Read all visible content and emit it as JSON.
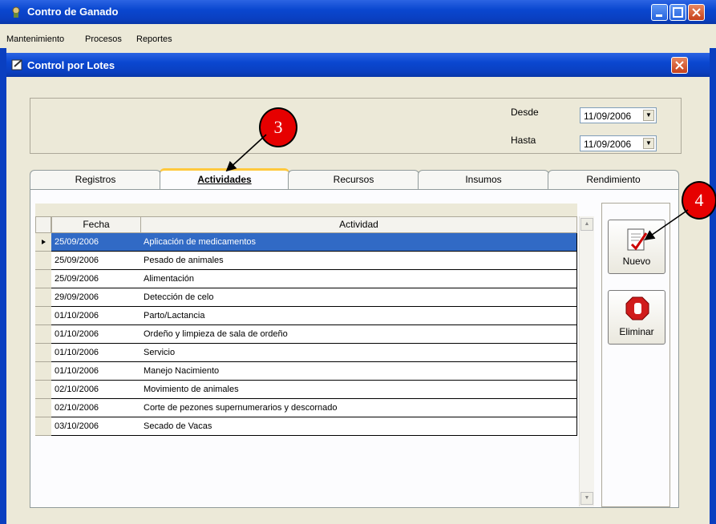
{
  "app": {
    "title": "Contro de Ganado"
  },
  "menu": [
    "Mantenimiento",
    "Procesos",
    "Reportes"
  ],
  "window": {
    "title": "Control por Lotes"
  },
  "dates": {
    "desde_label": "Desde",
    "desde_value": "11/09/2006",
    "hasta_label": "Hasta",
    "hasta_value": "11/09/2006"
  },
  "tabs": [
    {
      "label": "Registros",
      "active": false
    },
    {
      "label": "Actividades",
      "active": true
    },
    {
      "label": "Recursos",
      "active": false
    },
    {
      "label": "Insumos",
      "active": false
    },
    {
      "label": "Rendimiento",
      "active": false
    }
  ],
  "grid": {
    "headers": [
      "Fecha",
      "Actividad"
    ],
    "rows": [
      {
        "fecha": "25/09/2006",
        "actividad": "Aplicación de medicamentos",
        "selected": true
      },
      {
        "fecha": "25/09/2006",
        "actividad": "Pesado de animales"
      },
      {
        "fecha": "25/09/2006",
        "actividad": "Alimentación"
      },
      {
        "fecha": "29/09/2006",
        "actividad": "Detección de celo"
      },
      {
        "fecha": "01/10/2006",
        "actividad": "Parto/Lactancia"
      },
      {
        "fecha": "01/10/2006",
        "actividad": "Ordeño y limpieza de sala de ordeño"
      },
      {
        "fecha": "01/10/2006",
        "actividad": "Servicio"
      },
      {
        "fecha": "01/10/2006",
        "actividad": "Manejo Nacimiento"
      },
      {
        "fecha": "02/10/2006",
        "actividad": "Movimiento de animales"
      },
      {
        "fecha": "02/10/2006",
        "actividad": "Corte de pezones supernumerarios y descornado"
      },
      {
        "fecha": "03/10/2006",
        "actividad": "Secado de Vacas"
      }
    ]
  },
  "buttons": {
    "nuevo": "Nuevo",
    "eliminar": "Eliminar"
  },
  "callouts": [
    "3",
    "4"
  ],
  "colors": {
    "titlebar": "#0a47d0",
    "selection": "#316ac5",
    "callout": "#e60000",
    "active_tab_accent": "#ffc83c"
  }
}
